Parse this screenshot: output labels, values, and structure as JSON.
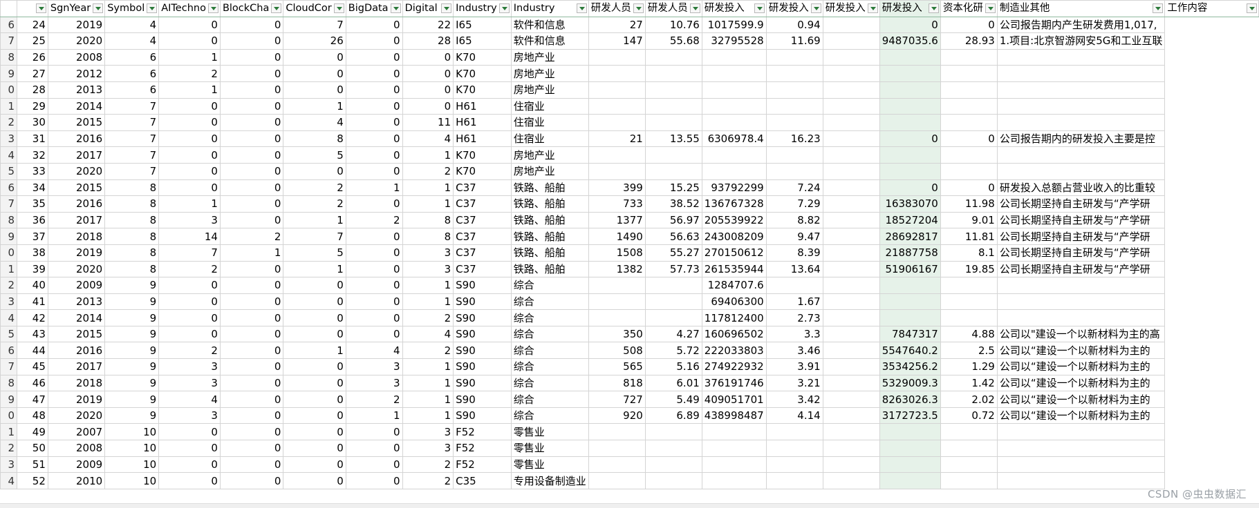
{
  "sheet": {
    "headers": [
      "",
      "SgnYear",
      "Symbol",
      "AITechno",
      "BlockCha",
      "CloudCor",
      "BigData",
      "Digital",
      "Industry",
      "Industry",
      "研发人员",
      "研发人员",
      "研发投入",
      "研发投入",
      "研发投入",
      "研发投入",
      "资本化研",
      "制造业其他",
      "工作内容"
    ],
    "rows": [
      [
        "6",
        "24",
        "2019",
        "4",
        "0",
        "0",
        "7",
        "0",
        "22",
        "I65",
        "软件和信息",
        "27",
        "10.76",
        "1017599.9",
        "0.94",
        "",
        "0",
        "0",
        "公司报告期内产生研发费用1,017,"
      ],
      [
        "7",
        "25",
        "2020",
        "4",
        "0",
        "0",
        "26",
        "0",
        "28",
        "I65",
        "软件和信息",
        "147",
        "55.68",
        "32795528",
        "11.69",
        "",
        "9487035.6",
        "28.93",
        "1.项目:北京智游网安5G和工业互联"
      ],
      [
        "8",
        "26",
        "2008",
        "6",
        "1",
        "0",
        "0",
        "0",
        "0",
        "K70",
        "房地产业",
        "",
        "",
        "",
        "",
        "",
        "",
        "",
        ""
      ],
      [
        "9",
        "27",
        "2012",
        "6",
        "2",
        "0",
        "0",
        "0",
        "0",
        "K70",
        "房地产业",
        "",
        "",
        "",
        "",
        "",
        "",
        "",
        ""
      ],
      [
        "0",
        "28",
        "2013",
        "6",
        "1",
        "0",
        "0",
        "0",
        "0",
        "K70",
        "房地产业",
        "",
        "",
        "",
        "",
        "",
        "",
        "",
        ""
      ],
      [
        "1",
        "29",
        "2014",
        "7",
        "0",
        "0",
        "1",
        "0",
        "0",
        "H61",
        "住宿业",
        "",
        "",
        "",
        "",
        "",
        "",
        "",
        ""
      ],
      [
        "2",
        "30",
        "2015",
        "7",
        "0",
        "0",
        "4",
        "0",
        "11",
        "H61",
        "住宿业",
        "",
        "",
        "",
        "",
        "",
        "",
        "",
        ""
      ],
      [
        "3",
        "31",
        "2016",
        "7",
        "0",
        "0",
        "8",
        "0",
        "4",
        "H61",
        "住宿业",
        "21",
        "13.55",
        "6306978.4",
        "16.23",
        "",
        "0",
        "0",
        "公司报告期内的研发投入主要是控"
      ],
      [
        "4",
        "32",
        "2017",
        "7",
        "0",
        "0",
        "5",
        "0",
        "1",
        "K70",
        "房地产业",
        "",
        "",
        "",
        "",
        "",
        "",
        "",
        ""
      ],
      [
        "5",
        "33",
        "2020",
        "7",
        "0",
        "0",
        "0",
        "0",
        "2",
        "K70",
        "房地产业",
        "",
        "",
        "",
        "",
        "",
        "",
        "",
        ""
      ],
      [
        "6",
        "34",
        "2015",
        "8",
        "0",
        "0",
        "2",
        "1",
        "1",
        "C37",
        "铁路、船舶",
        "399",
        "15.25",
        "93792299",
        "7.24",
        "",
        "0",
        "0",
        "研发投入总额占营业收入的比重较"
      ],
      [
        "7",
        "35",
        "2016",
        "8",
        "1",
        "0",
        "2",
        "0",
        "1",
        "C37",
        "铁路、船舶",
        "733",
        "38.52",
        "136767328",
        "7.29",
        "",
        "16383070",
        "11.98",
        "公司长期坚持自主研发与“产学研"
      ],
      [
        "8",
        "36",
        "2017",
        "8",
        "3",
        "0",
        "1",
        "2",
        "8",
        "C37",
        "铁路、船舶",
        "1377",
        "56.97",
        "205539922",
        "8.82",
        "",
        "18527204",
        "9.01",
        "公司长期坚持自主研发与“产学研"
      ],
      [
        "9",
        "37",
        "2018",
        "8",
        "14",
        "2",
        "7",
        "0",
        "8",
        "C37",
        "铁路、船舶",
        "1490",
        "56.63",
        "243008209",
        "9.47",
        "",
        "28692817",
        "11.81",
        "公司长期坚持自主研发与“产学研"
      ],
      [
        "0",
        "38",
        "2019",
        "8",
        "7",
        "1",
        "5",
        "0",
        "3",
        "C37",
        "铁路、船舶",
        "1508",
        "55.27",
        "270150612",
        "8.39",
        "",
        "21887758",
        "8.1",
        "公司长期坚持自主研发与“产学研"
      ],
      [
        "1",
        "39",
        "2020",
        "8",
        "2",
        "0",
        "1",
        "0",
        "3",
        "C37",
        "铁路、船舶",
        "1382",
        "57.73",
        "261535944",
        "13.64",
        "",
        "51906167",
        "19.85",
        "公司长期坚持自主研发与“产学研"
      ],
      [
        "2",
        "40",
        "2009",
        "9",
        "0",
        "0",
        "0",
        "0",
        "1",
        "S90",
        "综合",
        "",
        "",
        "1284707.6",
        "",
        "",
        "",
        "",
        ""
      ],
      [
        "3",
        "41",
        "2013",
        "9",
        "0",
        "0",
        "0",
        "0",
        "1",
        "S90",
        "综合",
        "",
        "",
        "69406300",
        "1.67",
        "",
        "",
        "",
        ""
      ],
      [
        "4",
        "42",
        "2014",
        "9",
        "0",
        "0",
        "0",
        "0",
        "2",
        "S90",
        "综合",
        "",
        "",
        "117812400",
        "2.73",
        "",
        "",
        "",
        ""
      ],
      [
        "5",
        "43",
        "2015",
        "9",
        "0",
        "0",
        "0",
        "0",
        "4",
        "S90",
        "综合",
        "350",
        "4.27",
        "160696502",
        "3.3",
        "",
        "7847317",
        "4.88",
        "公司以\"建设一个以新材料为主的高"
      ],
      [
        "6",
        "44",
        "2016",
        "9",
        "2",
        "0",
        "1",
        "4",
        "2",
        "S90",
        "综合",
        "508",
        "5.72",
        "222033803",
        "3.46",
        "",
        "5547640.2",
        "2.5",
        "公司以“建设一个以新材料为主的"
      ],
      [
        "7",
        "45",
        "2017",
        "9",
        "3",
        "0",
        "0",
        "3",
        "1",
        "S90",
        "综合",
        "565",
        "5.16",
        "274922932",
        "3.91",
        "",
        "3534256.2",
        "1.29",
        "公司以“建设一个以新材料为主的"
      ],
      [
        "8",
        "46",
        "2018",
        "9",
        "3",
        "0",
        "0",
        "3",
        "1",
        "S90",
        "综合",
        "818",
        "6.01",
        "376191746",
        "3.21",
        "",
        "5329009.3",
        "1.42",
        "公司以“建设一个以新材料为主的"
      ],
      [
        "9",
        "47",
        "2019",
        "9",
        "4",
        "0",
        "0",
        "2",
        "1",
        "S90",
        "综合",
        "727",
        "5.49",
        "409051701",
        "3.42",
        "",
        "8263026.3",
        "2.02",
        "公司以“建设一个以新材料为主的"
      ],
      [
        "0",
        "48",
        "2020",
        "9",
        "3",
        "0",
        "0",
        "1",
        "1",
        "S90",
        "综合",
        "920",
        "6.89",
        "438998487",
        "4.14",
        "",
        "3172723.5",
        "0.72",
        "公司以“建设一个以新材料为主的"
      ],
      [
        "1",
        "49",
        "2007",
        "10",
        "0",
        "0",
        "0",
        "0",
        "3",
        "F52",
        "零售业",
        "",
        "",
        "",
        "",
        "",
        "",
        "",
        ""
      ],
      [
        "2",
        "50",
        "2008",
        "10",
        "0",
        "0",
        "0",
        "0",
        "3",
        "F52",
        "零售业",
        "",
        "",
        "",
        "",
        "",
        "",
        "",
        ""
      ],
      [
        "3",
        "51",
        "2009",
        "10",
        "0",
        "0",
        "0",
        "0",
        "2",
        "F52",
        "零售业",
        "",
        "",
        "",
        "",
        "",
        "",
        "",
        ""
      ],
      [
        "4",
        "52",
        "2010",
        "10",
        "0",
        "0",
        "0",
        "0",
        "2",
        "C35",
        "专用设备制造业",
        "",
        "",
        "",
        "",
        "",
        "",
        "",
        ""
      ]
    ]
  },
  "watermark": "CSDN @虫虫数据汇"
}
